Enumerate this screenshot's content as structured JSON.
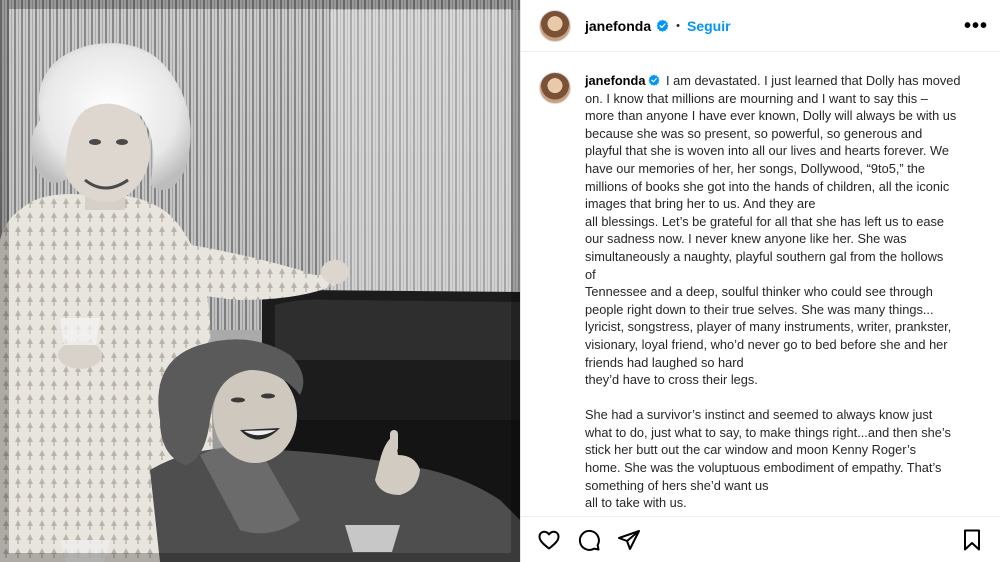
{
  "header": {
    "username": "janefonda",
    "separator": "•",
    "follow_label": "Seguir",
    "more_label": "•••"
  },
  "caption": {
    "username": "janefonda",
    "lines": [
      "I am devastated. I just learned that Dolly has moved",
      "on. I know that millions are mourning and I want to say this –",
      "more than anyone I have ever known, Dolly will always be with us",
      "because she was so present, so powerful, so generous and",
      "playful that she is woven into all our lives and hearts forever. We",
      "have our memories of her, her songs, Dollywood, “9to5,” the",
      "millions of books she got into the hands of children, all the iconic",
      "images that bring her to us. And they are",
      "all blessings. Let’s be grateful for all that she has left us to ease",
      "our sadness now. I never knew anyone like her. She was",
      "simultaneously a naughty, playful southern gal from the hollows",
      "of",
      "Tennessee and a deep, soulful thinker who could see through",
      "people right down to their true selves. She was many things...",
      "lyricist, songstress, player of many instruments, writer, prankster,",
      "visionary, loyal friend, who’d never go to bed before she and her",
      "friends had laughed so hard",
      "they’d have to cross their legs."
    ],
    "lines2": [
      "She had a survivor’s instinct and seemed to always know just",
      "what to do, just what to say, to make things right...and then she’s",
      "stick her butt out the car window and moon Kenny Roger’s",
      "home. She was the voluptuous embodiment of empathy. That’s",
      "something of hers she’d want us",
      "all to take with us."
    ]
  },
  "icons": {
    "verified": "verified-badge-icon",
    "like": "heart-icon",
    "comment": "comment-icon",
    "share": "paper-plane-icon",
    "save": "bookmark-icon"
  },
  "colors": {
    "link": "#0095f6",
    "verified": "#0095f6",
    "text": "#262626"
  }
}
